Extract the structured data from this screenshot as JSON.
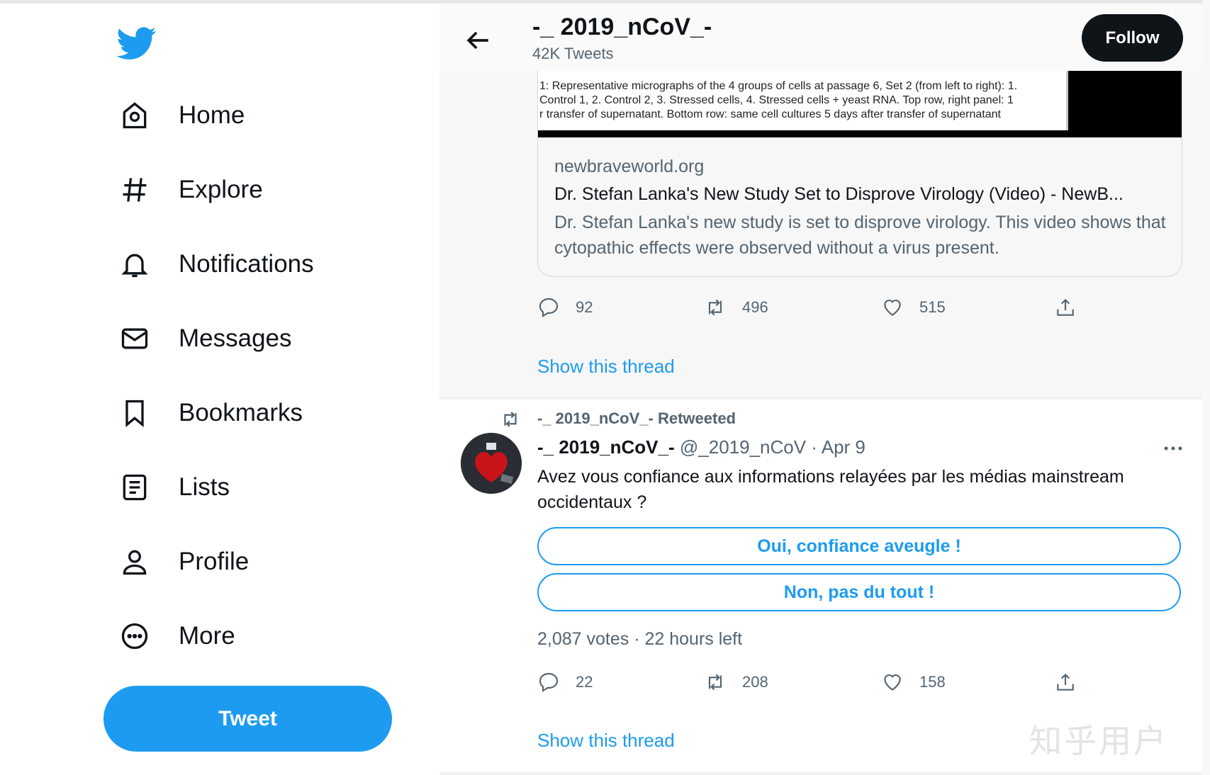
{
  "sidebar": {
    "nav": [
      {
        "label": "Home",
        "icon": "home-icon"
      },
      {
        "label": "Explore",
        "icon": "hashtag-icon"
      },
      {
        "label": "Notifications",
        "icon": "bell-icon"
      },
      {
        "label": "Messages",
        "icon": "envelope-icon"
      },
      {
        "label": "Bookmarks",
        "icon": "bookmark-icon"
      },
      {
        "label": "Lists",
        "icon": "list-icon"
      },
      {
        "label": "Profile",
        "icon": "person-icon"
      },
      {
        "label": "More",
        "icon": "more-circle-icon"
      }
    ],
    "tweet_button": "Tweet"
  },
  "header": {
    "title": "-_ 2019_nCoV_-",
    "subtitle": "42K Tweets",
    "follow_label": "Follow"
  },
  "tweet1": {
    "image_lines": [
      "1: Representative micrographs of the 4 groups of cells at passage 6, Set 2 (from left to right): 1.",
      "Control 1, 2. Control 2, 3. Stressed cells, 4. Stressed cells + yeast RNA. Top row, right panel: 1",
      "r transfer of supernatant. Bottom row: same cell cultures 5 days after transfer of supernatant"
    ],
    "card_domain": "newbraveworld.org",
    "card_title": "Dr. Stefan Lanka's New Study Set to Disprove Virology (Video) - NewB...",
    "card_description": "Dr. Stefan Lanka's new study is set to disprove virology. This video shows that cytopathic effects were observed without a virus present.",
    "replies": "92",
    "retweets": "496",
    "likes": "515",
    "show_thread": "Show this thread"
  },
  "tweet2": {
    "retweeted_by": "-_ 2019_nCoV_- Retweeted",
    "author_name": "-_ 2019_nCoV_-",
    "author_meta": " @_2019_nCoV · Apr 9",
    "text": "Avez vous confiance aux informations relayées par les médias mainstream occidentaux ?",
    "poll_options": [
      "Oui, confiance aveugle !",
      "Non, pas du tout !"
    ],
    "poll_meta": "2,087 votes · 22 hours left",
    "replies": "22",
    "retweets": "208",
    "likes": "158",
    "show_thread": "Show this thread"
  },
  "watermark": "知乎用户",
  "colors": {
    "accent": "#1d9bf0",
    "text": "#0f1419",
    "muted": "#536471"
  }
}
